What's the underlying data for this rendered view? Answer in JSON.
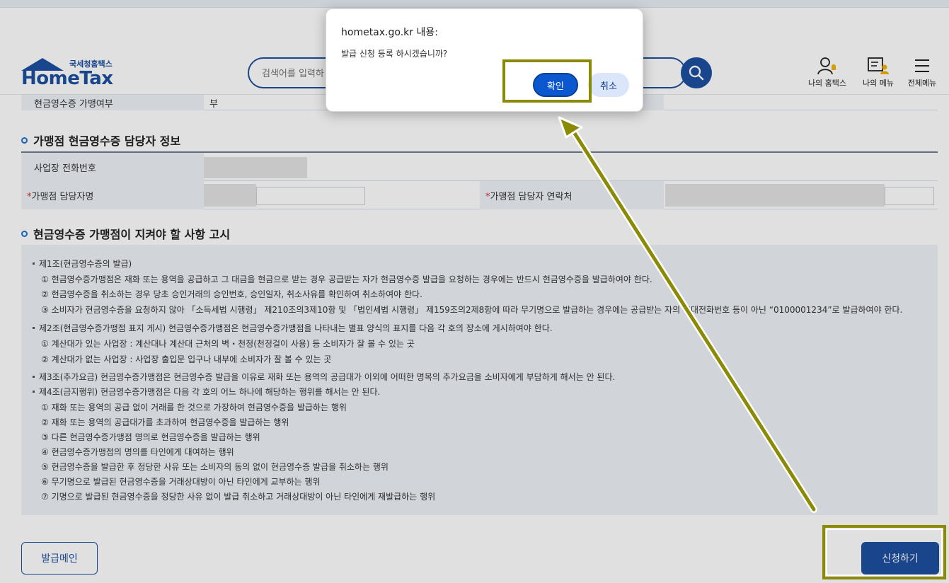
{
  "header": {
    "logo_sub": "국세청홈택스",
    "logo_main": "HomeTax",
    "search_placeholder": "검색어를 입력하",
    "nav": [
      {
        "label": "나의 홈택스"
      },
      {
        "label": "나의 메뉴"
      },
      {
        "label": "전체메뉴"
      }
    ]
  },
  "top_row": {
    "label": "현금영수증 가맹여부",
    "value": "부"
  },
  "section1": {
    "title": "가맹점 현금영수증 담당자 정보",
    "phone_label": "사업장 전화번호",
    "manager_label": "가맹점 담당자명",
    "contact_label": "가맹점 담당자 연락처",
    "required_mark": "*"
  },
  "section2": {
    "title": "현금영수증 가맹점이 지켜야 할 사항 고시",
    "lines": [
      "제1조(현금영수증의 발급)",
      "① 현금영수증가맹점은 재화 또는 용역을 공급하고 그 대금을 현금으로 받는 경우 공급받는 자가 현금영수증 발급을 요청하는 경우에는 반드시 현금영수증을 발급하여야 한다.",
      "② 현금영수증을 취소하는 경우 당초 승인거래의 승인번호, 승인일자, 취소사유를 확인하여 취소하여야 한다.",
      "③ 소비자가 현금영수증을 요청하지 않아 「소득세법 시행령」 제210조의3제10항 및 「법인세법 시행령」 제159조의2제8항에 따라 무기명으로 발급하는 경우에는 공급받는 자의 휴대전화번호 등이 아닌 “0100001234”로 발급하여야 한다.",
      "제2조(현금영수증가맹점 표지 게시) 현금영수증가맹점은 현금영수증가맹점을 나타내는 별표 양식의 표지를 다음 각 호의 장소에 게시하여야 한다.",
      "① 계산대가 있는 사업장 : 계산대나 계산대 근처의 벽・천정(천정걸이 사용) 등 소비자가 잘 볼 수 있는 곳",
      "② 계산대가 없는 사업장 : 사업장 출입문 입구나 내부에 소비자가 잘 볼 수 있는 곳",
      "제3조(추가요금) 현금영수증가맹점은 현금영수증 발급을 이유로 재화 또는 용역의 공급대가 이외에 어떠한 명목의 추가요금을 소비자에게 부담하게 해서는 안 된다.",
      "제4조(금지행위) 현금영수증가맹점은 다음 각 호의 어느 하나에 해당하는 행위를 해서는 안 된다.",
      "① 재화 또는 용역의 공급 없이 거래를 한 것으로 가장하여 현금영수증을 발급하는 행위",
      "② 재화 또는 용역의 공급대가를 초과하여 현금영수증을 발급하는 행위",
      "③ 다른 현금영수증가맹점 명의로 현금영수증을 발급하는 행위",
      "④ 현금영수증가맹점의 명의를 타인에게 대여하는 행위",
      "⑤ 현금영수증을 발급한 후 정당한 사유 또는 소비자의 동의 없이 현금영수증 발급을 취소하는 행위",
      "⑥ 무기명으로 발급된 현금영수증을 거래상대방이 아닌 타인에게 교부하는 행위",
      "⑦ 기명으로 발급된 현금영수증을 정당한 사유 없이 발급 취소하고 거래상대방이 아닌 타인에게 재발급하는 행위"
    ]
  },
  "buttons": {
    "main": "발급메인",
    "apply": "신청하기"
  },
  "dialog": {
    "title": "hometax.go.kr 내용:",
    "message": "발급 신청 등록 하시겠습니까?",
    "ok": "확인",
    "cancel": "취소"
  },
  "colors": {
    "brand": "#1d4fa0",
    "dialog_ok": "#0b57d0",
    "highlight": "#8a8a05"
  }
}
